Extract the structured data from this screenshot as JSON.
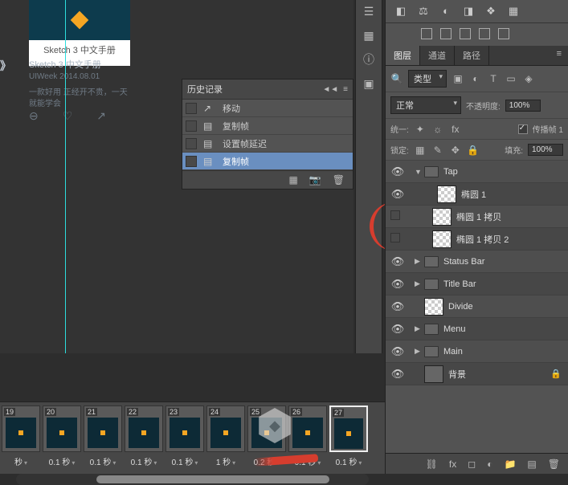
{
  "canvas": {
    "doc_label": "Sketch 3 中文手册",
    "meta_title": "Sketch 3 中文手册",
    "meta_sub": "UIWeek   2014.08.01",
    "meta_desc": "一款好用   正经开不贵，一天\n就能学会",
    "arrow_left": "》"
  },
  "history": {
    "title": "历史记录",
    "items": [
      {
        "icon": "↗",
        "label": "移动",
        "selected": false
      },
      {
        "icon": "▤",
        "label": "复制帧",
        "selected": false
      },
      {
        "icon": "▤",
        "label": "设置帧延迟",
        "selected": false
      },
      {
        "icon": "▤",
        "label": "复制帧",
        "selected": true
      }
    ],
    "footer_icons": [
      "▦",
      "📷",
      "🗑"
    ]
  },
  "tabs": {
    "layers": "图层",
    "channels": "通道",
    "paths": "路径"
  },
  "filter": {
    "kind_label": "类型",
    "blend_label": "正常",
    "opacity_label": "不透明度:",
    "opacity_value": "100%",
    "unify_label": "统一:",
    "propagate_label": "传播帧 1",
    "lock_label": "锁定:",
    "fill_label": "填充:",
    "fill_value": "100%"
  },
  "layers": [
    {
      "vis": true,
      "indent": 0,
      "expand": "▼",
      "type": "folder",
      "name": "Tap"
    },
    {
      "vis": true,
      "indent": 1,
      "expand": "",
      "type": "thumb",
      "name": "椭圆 1"
    },
    {
      "vis": false,
      "indent": 1,
      "expand": "",
      "type": "thumb",
      "name": "椭圆 1 拷贝"
    },
    {
      "vis": false,
      "indent": 1,
      "expand": "",
      "type": "thumb",
      "name": "椭圆 1 拷贝 2"
    },
    {
      "vis": true,
      "indent": 0,
      "expand": "▶",
      "type": "folder",
      "name": "Status Bar"
    },
    {
      "vis": true,
      "indent": 0,
      "expand": "▶",
      "type": "folder",
      "name": "Title Bar"
    },
    {
      "vis": true,
      "indent": 0,
      "expand": "",
      "type": "thumb",
      "name": "Divide"
    },
    {
      "vis": true,
      "indent": 0,
      "expand": "▶",
      "type": "folder",
      "name": "Menu"
    },
    {
      "vis": true,
      "indent": 0,
      "expand": "▶",
      "type": "folder",
      "name": "Main"
    },
    {
      "vis": true,
      "indent": 0,
      "expand": "",
      "type": "gray",
      "name": "背景",
      "locked": true
    }
  ],
  "frames": [
    {
      "num": "19",
      "dur": "秒"
    },
    {
      "num": "20",
      "dur": "0.1 秒"
    },
    {
      "num": "21",
      "dur": "0.1 秒"
    },
    {
      "num": "22",
      "dur": "0.1 秒"
    },
    {
      "num": "23",
      "dur": "0.1 秒"
    },
    {
      "num": "24",
      "dur": "1 秒"
    },
    {
      "num": "25",
      "dur": "0.2 秒"
    },
    {
      "num": "26",
      "dur": "0.1 秒"
    },
    {
      "num": "27",
      "dur": "0.1 秒",
      "selected": true
    }
  ]
}
